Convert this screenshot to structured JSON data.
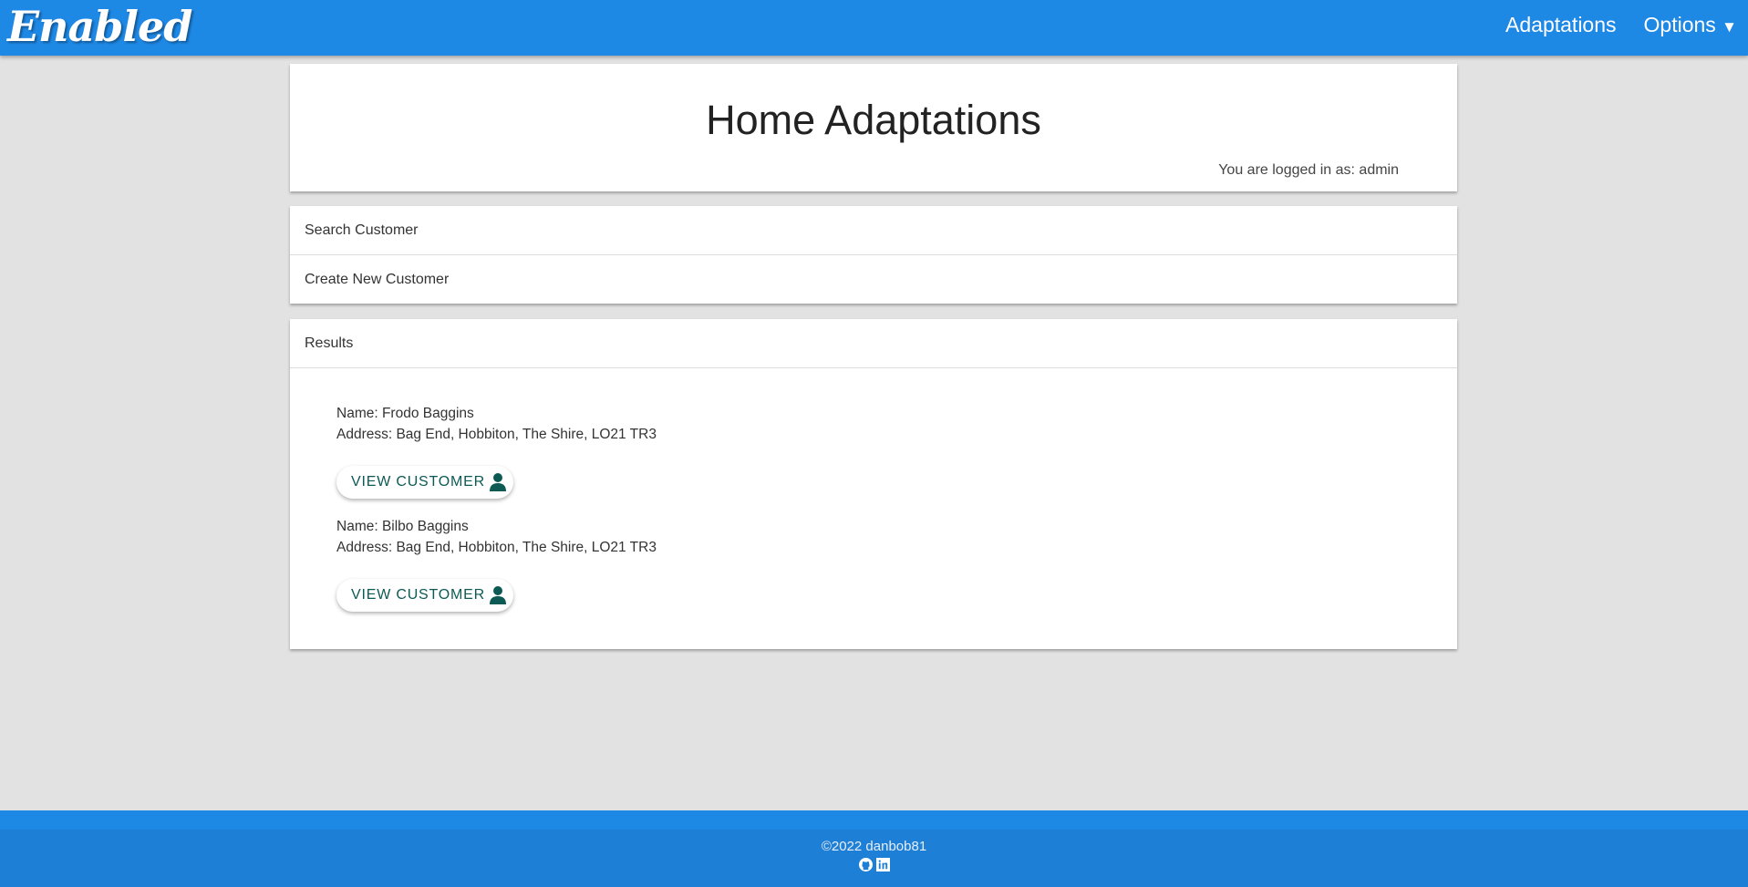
{
  "nav": {
    "logo": "Enabled",
    "links": [
      "Adaptations",
      "Options"
    ]
  },
  "header": {
    "title": "Home Adaptations",
    "logged_in": "You are logged in as: admin"
  },
  "menu": {
    "items": [
      "Search Customer",
      "Create New Customer"
    ]
  },
  "results": {
    "heading": "Results",
    "button_label": "VIEW CUSTOMER",
    "customers": [
      {
        "name": "Name: Frodo Baggins",
        "address": "Address: Bag End, Hobbiton, The Shire, LO21 TR3"
      },
      {
        "name": "Name: Bilbo Baggins",
        "address": "Address: Bag End, Hobbiton, The Shire, LO21 TR3"
      }
    ]
  },
  "footer": {
    "copyright": "©2022 danbob81"
  },
  "colors": {
    "nav": "#1e88e5",
    "button_text": "#0d5a55"
  }
}
